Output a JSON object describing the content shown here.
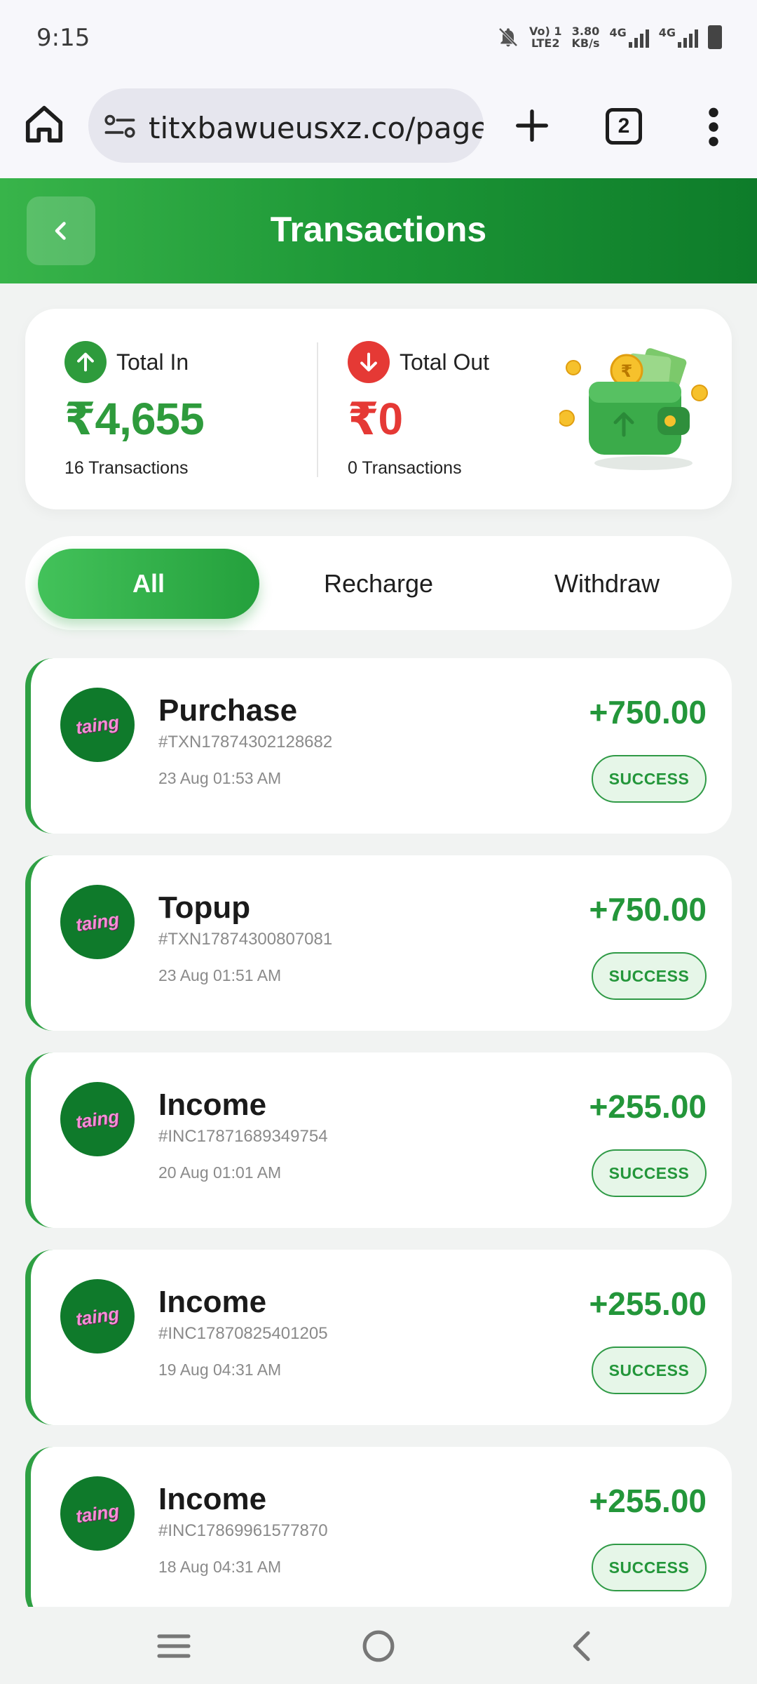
{
  "status_bar": {
    "time": "9:15",
    "volte_top": "Vo) 1",
    "volte_bottom": "LTE2",
    "speed_top": "3.80",
    "speed_bottom": "KB/s",
    "net1": "4G",
    "net2": "4G"
  },
  "browser": {
    "url": "titxbawueusxz.co/pages",
    "tab_count": "2"
  },
  "header": {
    "title": "Transactions"
  },
  "summary": {
    "total_in": {
      "label": "Total In",
      "amount": "₹4,655",
      "count": "16 Transactions",
      "color": "#2e9b3c"
    },
    "total_out": {
      "label": "Total Out",
      "amount": "₹0",
      "count": "0 Transactions",
      "color": "#e53935"
    }
  },
  "filters": {
    "tabs": [
      {
        "label": "All",
        "active": true
      },
      {
        "label": "Recharge",
        "active": false
      },
      {
        "label": "Withdraw",
        "active": false
      }
    ]
  },
  "transactions": [
    {
      "title": "Purchase",
      "id": "#TXN17874302128682",
      "date": "23 Aug 01:53 AM",
      "amount": "+750.00",
      "status": "SUCCESS",
      "logo": "taing"
    },
    {
      "title": "Topup",
      "id": "#TXN17874300807081",
      "date": "23 Aug 01:51 AM",
      "amount": "+750.00",
      "status": "SUCCESS",
      "logo": "taing"
    },
    {
      "title": "Income",
      "id": "#INC17871689349754",
      "date": "20 Aug 01:01 AM",
      "amount": "+255.00",
      "status": "SUCCESS",
      "logo": "taing"
    },
    {
      "title": "Income",
      "id": "#INC17870825401205",
      "date": "19 Aug 04:31 AM",
      "amount": "+255.00",
      "status": "SUCCESS",
      "logo": "taing"
    },
    {
      "title": "Income",
      "id": "#INC17869961577870",
      "date": "18 Aug 04:31 AM",
      "amount": "+255.00",
      "status": "SUCCESS",
      "logo": "taing"
    }
  ],
  "colors": {
    "brand_green": "#1c9636",
    "accent_green": "#23963a",
    "danger_red": "#e53935"
  }
}
